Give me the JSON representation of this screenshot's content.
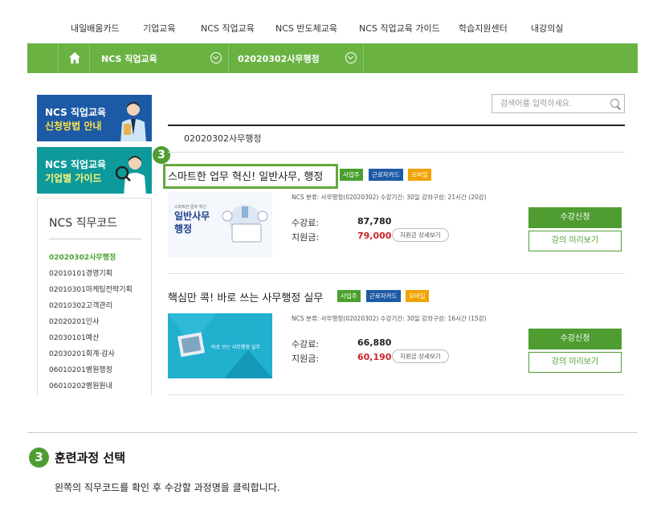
{
  "top_nav": [
    "내일배움카드",
    "기업교육",
    "NCS 직업교육",
    "NCS 반도체교육",
    "NCS 직업교육 가이드",
    "학습지원센터",
    "내강의실"
  ],
  "breadcrumb": {
    "level1": "NCS 직업교육",
    "level2": "02020302사무행정"
  },
  "banners": [
    {
      "line1": "NCS 직업교육",
      "line2": "신청방법 안내"
    },
    {
      "line1": "NCS 직업교육",
      "line2": "기업별 가이드"
    }
  ],
  "sidebar": {
    "title": "NCS 직무코드",
    "codes": [
      "02020302사무행정",
      "02010101경영기획",
      "02010301마케팅전략기획",
      "02010302고객관리",
      "02020201인사",
      "02030101예산",
      "02030201회계·감사",
      "06010201병원행정",
      "06010202병원원내"
    ]
  },
  "search": {
    "placeholder": "검색어를 입력하세요."
  },
  "page_heading": "02020302사무행정",
  "courses": [
    {
      "title": "스마트한 업무 혁신! 일반사무, 행정",
      "badges": [
        "사업주",
        "근로자카드",
        "모바일"
      ],
      "meta": "NCS 분류: 사무행정(02020302)   수강기간: 30일   강좌구성: 21시간 (20강)",
      "fee_label": "수강료:",
      "fee": "87,780",
      "support_label": "지원금:",
      "support": "79,000",
      "detail_label": "지원금 상세보기",
      "apply_label": "수강신청",
      "preview_label": "강의 미리보기",
      "thumb_text_small": "스마트한 업무 혁신",
      "thumb_text": "일반사무",
      "thumb_text2": "행정"
    },
    {
      "title": "핵심만 콕! 바로 쓰는 사무행정 실무",
      "badges": [
        "사업주",
        "근로자카드",
        "모바일"
      ],
      "meta": "NCS 분류: 사무행정(02020302)   수강기간: 30일   강좌구성: 16시간 (15강)",
      "fee_label": "수강료:",
      "fee": "66,880",
      "support_label": "지원금:",
      "support": "60,190",
      "detail_label": "지원금 상세보기",
      "apply_label": "수강신청",
      "preview_label": "강의 미리보기",
      "thumb_text": "바로 쓰는 사무행정 실무"
    }
  ],
  "step": {
    "number": "3",
    "title": "훈련과정 선택",
    "description": "왼쪽의 직무코드를 확인 후 수강할 과정명을 클릭합니다."
  },
  "colors": {
    "green": "#6ab343",
    "dark_green": "#4f9d31",
    "blue": "#1d5aa5",
    "teal": "#0e9a9a",
    "red": "#c8242b",
    "orange": "#f0a300"
  }
}
